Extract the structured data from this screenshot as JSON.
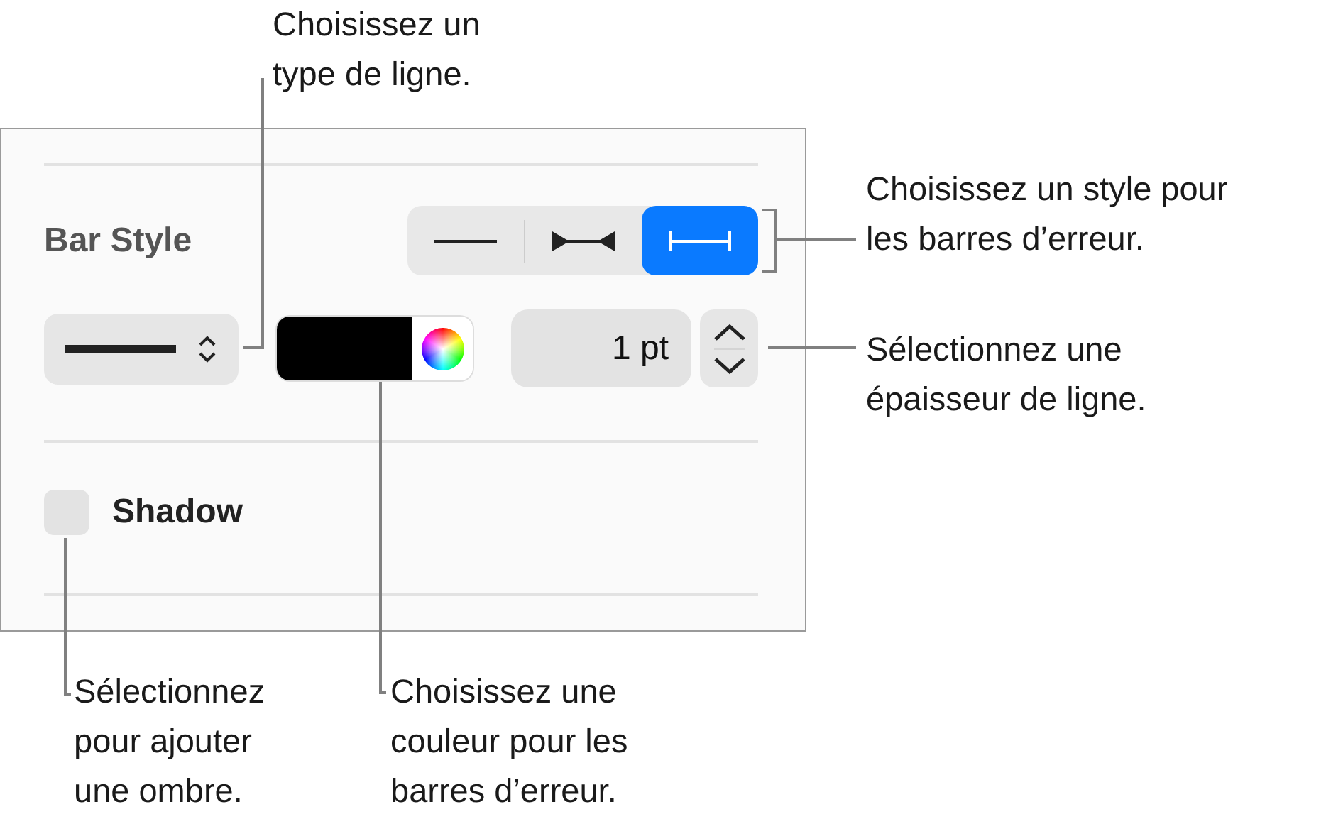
{
  "panel": {
    "section_label": "Bar Style",
    "bar_styles": [
      {
        "kind": "line",
        "selected": false
      },
      {
        "kind": "inward-arrows",
        "selected": false
      },
      {
        "kind": "caps",
        "selected": true
      }
    ],
    "thickness": "1 pt",
    "shadow": {
      "label": "Shadow",
      "checked": false
    }
  },
  "callouts": [
    {
      "text": "Choisissez un\ntype de ligne."
    },
    {
      "text": "Choisissez un style pour\nles barres d’erreur."
    },
    {
      "text": "Sélectionnez une\népaisseur de ligne."
    },
    {
      "text": "Sélectionnez\npour ajouter\nune ombre."
    },
    {
      "text": "Choisissez une\ncouleur pour les\nbarres d’erreur."
    }
  ]
}
